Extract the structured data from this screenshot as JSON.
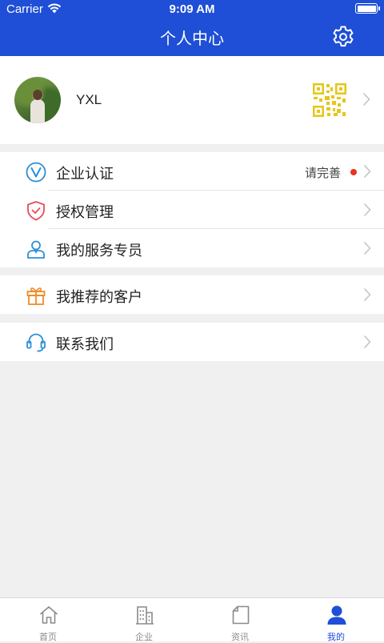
{
  "status_bar": {
    "carrier": "Carrier",
    "time": "9:09 AM"
  },
  "nav": {
    "title": "个人中心",
    "settings_icon": "gear-icon"
  },
  "profile": {
    "name": "YXL",
    "qr_icon": "qr-code-icon",
    "qr_color": "#e6c619"
  },
  "menu_groups": [
    [
      {
        "label": "企业认证",
        "icon": "verified-v-icon",
        "hint": "请完善",
        "dot_color": "#e8341c"
      },
      {
        "label": "授权管理",
        "icon": "shield-check-icon"
      },
      {
        "label": "我的服务专员",
        "icon": "service-person-icon"
      }
    ],
    [
      {
        "label": "我推荐的客户",
        "icon": "gift-icon"
      }
    ],
    [
      {
        "label": "联系我们",
        "icon": "headset-icon"
      }
    ]
  ],
  "tabs": [
    {
      "label": "首页",
      "icon": "home-icon"
    },
    {
      "label": "企业",
      "icon": "building-icon"
    },
    {
      "label": "资讯",
      "icon": "news-icon"
    },
    {
      "label": "我的",
      "icon": "user-icon",
      "active": true
    }
  ],
  "colors": {
    "primary": "#1e4fd6",
    "background": "#f0f0f0",
    "shield": "#e84c5a",
    "gift": "#f08a24",
    "service": "#2a8fd8"
  }
}
